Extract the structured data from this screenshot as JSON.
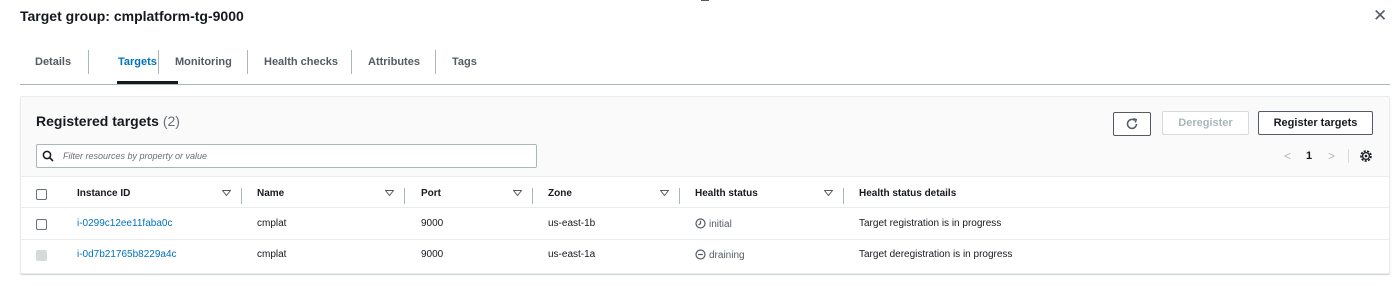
{
  "header": {
    "title": "Target group: cmplatform-tg-9000",
    "close_icon": "close-icon"
  },
  "tabs": [
    {
      "label": "Details",
      "active": false
    },
    {
      "label": "Targets",
      "active": true
    },
    {
      "label": "Monitoring",
      "active": false
    },
    {
      "label": "Health checks",
      "active": false
    },
    {
      "label": "Attributes",
      "active": false
    },
    {
      "label": "Tags",
      "active": false
    }
  ],
  "panel": {
    "title": "Registered targets",
    "count": "(2)",
    "refresh_icon": "refresh-icon",
    "deregister_label": "Deregister",
    "register_label": "Register targets",
    "search_placeholder": "Filter resources by property or value",
    "search_value": "",
    "page": "1",
    "pager_prev": "<",
    "pager_next": ">"
  },
  "table": {
    "columns": [
      "Instance ID",
      "Name",
      "Port",
      "Zone",
      "Health status",
      "Health status details"
    ],
    "rows": [
      {
        "instance_id": "i-0299c12ee11faba0c",
        "name": "cmplat",
        "port": "9000",
        "zone": "us-east-1b",
        "health": "initial",
        "details": "Target registration is in progress",
        "selectable": true
      },
      {
        "instance_id": "i-0d7b21765b8229a4c",
        "name": "cmplat",
        "port": "9000",
        "zone": "us-east-1a",
        "health": "draining",
        "details": "Target deregistration is in progress",
        "selectable": false
      }
    ]
  },
  "colors": {
    "link": "#0073bb",
    "text": "#16191f",
    "muted": "#545b64",
    "border": "#aab7b8"
  }
}
